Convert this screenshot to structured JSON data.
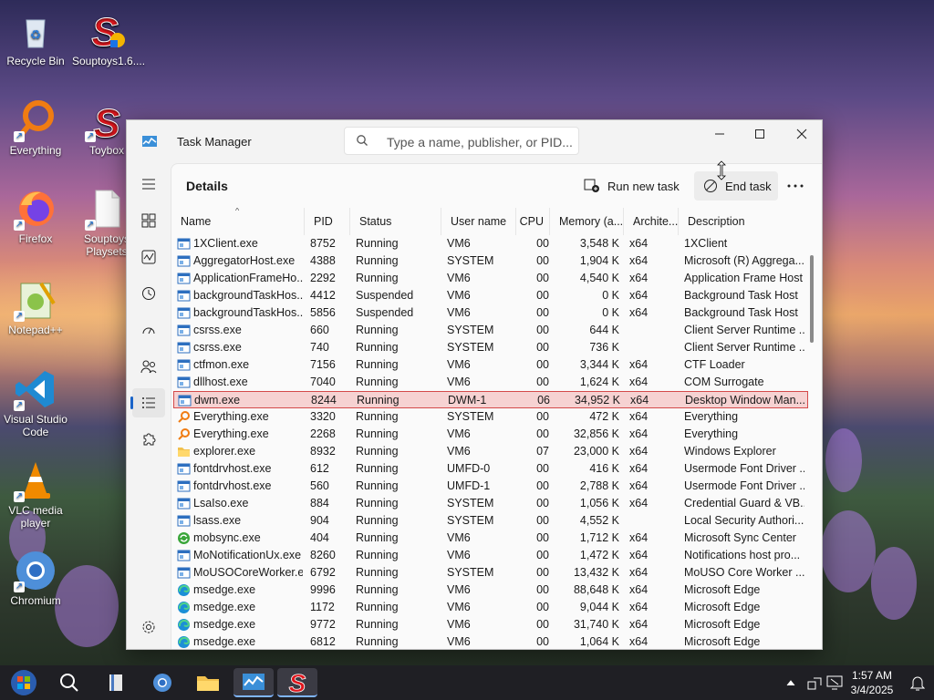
{
  "desktop": {
    "icons": [
      {
        "label": "Recycle Bin"
      },
      {
        "label": "Souptoys1.6...."
      },
      {
        "label": "Everything"
      },
      {
        "label": "Toybox"
      },
      {
        "label": "Firefox"
      },
      {
        "label": "Souptoys Playsets"
      },
      {
        "label": "Notepad++"
      },
      {
        "label": "Visual Studio Code"
      },
      {
        "label": "VLC media player"
      },
      {
        "label": "Chromium"
      }
    ]
  },
  "window": {
    "title": "Task Manager",
    "search_placeholder": "Type a name, publisher, or PID..."
  },
  "page": {
    "title": "Details",
    "run_new_task": "Run new task",
    "end_task": "End task"
  },
  "columns": {
    "name": "Name",
    "pid": "PID",
    "status": "Status",
    "user": "User name",
    "cpu": "CPU",
    "memory": "Memory (a...",
    "arch": "Archite...",
    "desc": "Description"
  },
  "processes": [
    {
      "name": "1XClient.exe",
      "pid": "8752",
      "status": "Running",
      "user": "VM6",
      "cpu": "00",
      "mem": "3,548 K",
      "arch": "x64",
      "desc": "1XClient",
      "icon": "window-icon"
    },
    {
      "name": "AggregatorHost.exe",
      "pid": "4388",
      "status": "Running",
      "user": "SYSTEM",
      "cpu": "00",
      "mem": "1,904 K",
      "arch": "x64",
      "desc": "Microsoft (R) Aggrega...",
      "icon": "window-icon"
    },
    {
      "name": "ApplicationFrameHo...",
      "pid": "2292",
      "status": "Running",
      "user": "VM6",
      "cpu": "00",
      "mem": "4,540 K",
      "arch": "x64",
      "desc": "Application Frame Host",
      "icon": "window-icon"
    },
    {
      "name": "backgroundTaskHos...",
      "pid": "4412",
      "status": "Suspended",
      "user": "VM6",
      "cpu": "00",
      "mem": "0 K",
      "arch": "x64",
      "desc": "Background Task Host",
      "icon": "window-icon"
    },
    {
      "name": "backgroundTaskHos...",
      "pid": "5856",
      "status": "Suspended",
      "user": "VM6",
      "cpu": "00",
      "mem": "0 K",
      "arch": "x64",
      "desc": "Background Task Host",
      "icon": "window-icon"
    },
    {
      "name": "csrss.exe",
      "pid": "660",
      "status": "Running",
      "user": "SYSTEM",
      "cpu": "00",
      "mem": "644 K",
      "arch": "",
      "desc": "Client Server Runtime ...",
      "icon": "window-icon"
    },
    {
      "name": "csrss.exe",
      "pid": "740",
      "status": "Running",
      "user": "SYSTEM",
      "cpu": "00",
      "mem": "736 K",
      "arch": "",
      "desc": "Client Server Runtime ...",
      "icon": "window-icon"
    },
    {
      "name": "ctfmon.exe",
      "pid": "7156",
      "status": "Running",
      "user": "VM6",
      "cpu": "00",
      "mem": "3,344 K",
      "arch": "x64",
      "desc": "CTF Loader",
      "icon": "window-icon"
    },
    {
      "name": "dllhost.exe",
      "pid": "7040",
      "status": "Running",
      "user": "VM6",
      "cpu": "00",
      "mem": "1,624 K",
      "arch": "x64",
      "desc": "COM Surrogate",
      "icon": "window-icon"
    },
    {
      "name": "dwm.exe",
      "pid": "8244",
      "status": "Running",
      "user": "DWM-1",
      "cpu": "06",
      "mem": "34,952 K",
      "arch": "x64",
      "desc": "Desktop Window Man...",
      "icon": "window-icon",
      "selected": true
    },
    {
      "name": "Everything.exe",
      "pid": "3320",
      "status": "Running",
      "user": "SYSTEM",
      "cpu": "00",
      "mem": "472 K",
      "arch": "x64",
      "desc": "Everything",
      "icon": "everything-icon"
    },
    {
      "name": "Everything.exe",
      "pid": "2268",
      "status": "Running",
      "user": "VM6",
      "cpu": "00",
      "mem": "32,856 K",
      "arch": "x64",
      "desc": "Everything",
      "icon": "everything-icon"
    },
    {
      "name": "explorer.exe",
      "pid": "8932",
      "status": "Running",
      "user": "VM6",
      "cpu": "07",
      "mem": "23,000 K",
      "arch": "x64",
      "desc": "Windows Explorer",
      "icon": "folder-icon"
    },
    {
      "name": "fontdrvhost.exe",
      "pid": "612",
      "status": "Running",
      "user": "UMFD-0",
      "cpu": "00",
      "mem": "416 K",
      "arch": "x64",
      "desc": "Usermode Font Driver ...",
      "icon": "window-icon"
    },
    {
      "name": "fontdrvhost.exe",
      "pid": "560",
      "status": "Running",
      "user": "UMFD-1",
      "cpu": "00",
      "mem": "2,788 K",
      "arch": "x64",
      "desc": "Usermode Font Driver ...",
      "icon": "window-icon"
    },
    {
      "name": "LsaIso.exe",
      "pid": "884",
      "status": "Running",
      "user": "SYSTEM",
      "cpu": "00",
      "mem": "1,056 K",
      "arch": "x64",
      "desc": "Credential Guard & VB...",
      "icon": "window-icon"
    },
    {
      "name": "lsass.exe",
      "pid": "904",
      "status": "Running",
      "user": "SYSTEM",
      "cpu": "00",
      "mem": "4,552 K",
      "arch": "",
      "desc": "Local Security Authori...",
      "icon": "window-icon"
    },
    {
      "name": "mobsync.exe",
      "pid": "404",
      "status": "Running",
      "user": "VM6",
      "cpu": "00",
      "mem": "1,712 K",
      "arch": "x64",
      "desc": "Microsoft Sync Center",
      "icon": "sync-icon"
    },
    {
      "name": "MoNotificationUx.exe",
      "pid": "8260",
      "status": "Running",
      "user": "VM6",
      "cpu": "00",
      "mem": "1,472 K",
      "arch": "x64",
      "desc": "Notifications host pro...",
      "icon": "window-icon"
    },
    {
      "name": "MoUSOCoreWorker.e...",
      "pid": "6792",
      "status": "Running",
      "user": "SYSTEM",
      "cpu": "00",
      "mem": "13,432 K",
      "arch": "x64",
      "desc": "MoUSO Core Worker ...",
      "icon": "window-icon"
    },
    {
      "name": "msedge.exe",
      "pid": "9996",
      "status": "Running",
      "user": "VM6",
      "cpu": "00",
      "mem": "88,648 K",
      "arch": "x64",
      "desc": "Microsoft Edge",
      "icon": "edge-icon"
    },
    {
      "name": "msedge.exe",
      "pid": "1172",
      "status": "Running",
      "user": "VM6",
      "cpu": "00",
      "mem": "9,044 K",
      "arch": "x64",
      "desc": "Microsoft Edge",
      "icon": "edge-icon"
    },
    {
      "name": "msedge.exe",
      "pid": "9772",
      "status": "Running",
      "user": "VM6",
      "cpu": "00",
      "mem": "31,740 K",
      "arch": "x64",
      "desc": "Microsoft Edge",
      "icon": "edge-icon"
    },
    {
      "name": "msedge.exe",
      "pid": "6812",
      "status": "Running",
      "user": "VM6",
      "cpu": "00",
      "mem": "1,064 K",
      "arch": "x64",
      "desc": "Microsoft Edge",
      "icon": "edge-icon"
    }
  ],
  "taskbar": {
    "time": "1:57 AM",
    "date": "3/4/2025"
  }
}
